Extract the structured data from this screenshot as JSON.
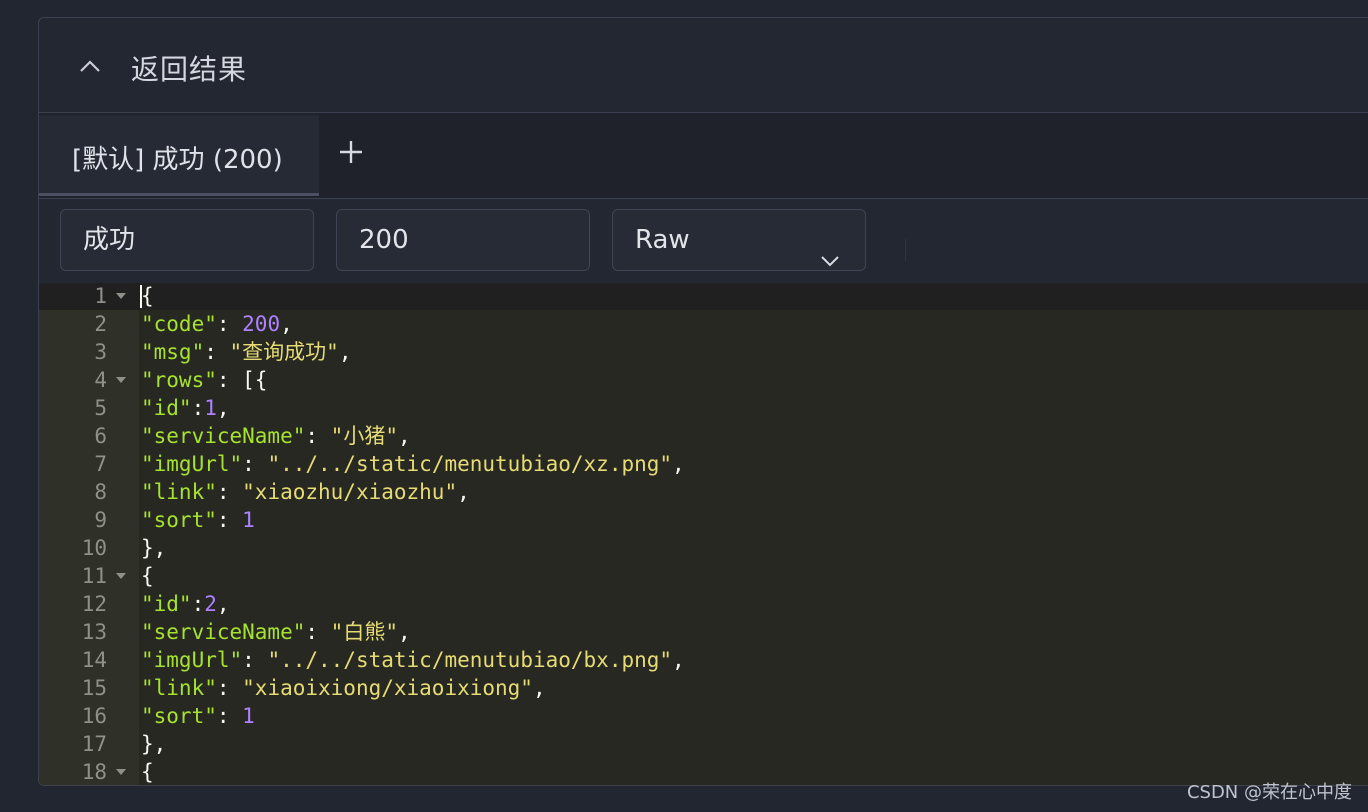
{
  "section": {
    "title": "返回结果",
    "toggle_icon": "chevron-up-icon"
  },
  "tabs": [
    {
      "label": "[默认] 成功 (200)",
      "active": true
    }
  ],
  "add_tab_icon": "plus-icon",
  "fields": {
    "name_value": "成功",
    "status_code_value": "200",
    "format_selected": "Raw",
    "format_icon": "chevron-down-icon"
  },
  "colors": {
    "editor_bg": "#272822",
    "key": "#a6e22e",
    "number": "#ae81ff",
    "string": "#e6db74",
    "punct": "#f8f8f2",
    "line_number": "#8f908a"
  },
  "editor": {
    "lines": [
      {
        "num": "1",
        "fold": true,
        "tokens": [
          [
            "p",
            "{"
          ]
        ]
      },
      {
        "num": "2",
        "fold": false,
        "tokens": [
          [
            "key",
            "\"code\""
          ],
          [
            "p",
            ": "
          ],
          [
            "num",
            "200"
          ],
          [
            "p",
            ","
          ]
        ]
      },
      {
        "num": "3",
        "fold": false,
        "tokens": [
          [
            "key",
            "\"msg\""
          ],
          [
            "p",
            ": "
          ],
          [
            "str",
            "\"查询成功\""
          ],
          [
            "p",
            ","
          ]
        ]
      },
      {
        "num": "4",
        "fold": true,
        "tokens": [
          [
            "key",
            "\"rows\""
          ],
          [
            "p",
            ": [{"
          ]
        ]
      },
      {
        "num": "5",
        "fold": false,
        "tokens": [
          [
            "key",
            "\"id\""
          ],
          [
            "p",
            ":"
          ],
          [
            "num",
            "1"
          ],
          [
            "p",
            ","
          ]
        ]
      },
      {
        "num": "6",
        "fold": false,
        "tokens": [
          [
            "key",
            "\"serviceName\""
          ],
          [
            "p",
            ": "
          ],
          [
            "str",
            "\"小猪\""
          ],
          [
            "p",
            ","
          ]
        ]
      },
      {
        "num": "7",
        "fold": false,
        "tokens": [
          [
            "key",
            "\"imgUrl\""
          ],
          [
            "p",
            ": "
          ],
          [
            "str",
            "\"../../static/menutubiao/xz.png\""
          ],
          [
            "p",
            ","
          ]
        ]
      },
      {
        "num": "8",
        "fold": false,
        "tokens": [
          [
            "key",
            "\"link\""
          ],
          [
            "p",
            ": "
          ],
          [
            "str",
            "\"xiaozhu/xiaozhu\""
          ],
          [
            "p",
            ","
          ]
        ]
      },
      {
        "num": "9",
        "fold": false,
        "tokens": [
          [
            "key",
            "\"sort\""
          ],
          [
            "p",
            ": "
          ],
          [
            "num",
            "1"
          ]
        ]
      },
      {
        "num": "10",
        "fold": false,
        "tokens": [
          [
            "p",
            "},"
          ]
        ]
      },
      {
        "num": "11",
        "fold": true,
        "tokens": [
          [
            "p",
            "{"
          ]
        ]
      },
      {
        "num": "12",
        "fold": false,
        "tokens": [
          [
            "key",
            "\"id\""
          ],
          [
            "p",
            ":"
          ],
          [
            "num",
            "2"
          ],
          [
            "p",
            ","
          ]
        ]
      },
      {
        "num": "13",
        "fold": false,
        "tokens": [
          [
            "key",
            "\"serviceName\""
          ],
          [
            "p",
            ": "
          ],
          [
            "str",
            "\"白熊\""
          ],
          [
            "p",
            ","
          ]
        ]
      },
      {
        "num": "14",
        "fold": false,
        "tokens": [
          [
            "key",
            "\"imgUrl\""
          ],
          [
            "p",
            ": "
          ],
          [
            "str",
            "\"../../static/menutubiao/bx.png\""
          ],
          [
            "p",
            ","
          ]
        ]
      },
      {
        "num": "15",
        "fold": false,
        "tokens": [
          [
            "key",
            "\"link\""
          ],
          [
            "p",
            ": "
          ],
          [
            "str",
            "\"xiaoixiong/xiaoixiong\""
          ],
          [
            "p",
            ","
          ]
        ]
      },
      {
        "num": "16",
        "fold": false,
        "tokens": [
          [
            "key",
            "\"sort\""
          ],
          [
            "p",
            ": "
          ],
          [
            "num",
            "1"
          ]
        ]
      },
      {
        "num": "17",
        "fold": false,
        "tokens": [
          [
            "p",
            "},"
          ]
        ]
      },
      {
        "num": "18",
        "fold": true,
        "tokens": [
          [
            "p",
            "{"
          ]
        ]
      }
    ]
  },
  "watermark": "CSDN @荣在心中度"
}
